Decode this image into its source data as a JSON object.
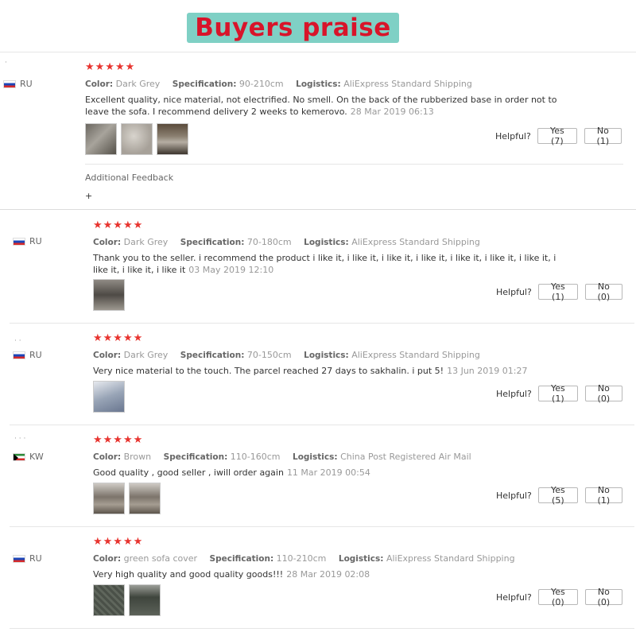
{
  "banner": {
    "title": "Buyers praise"
  },
  "labels": {
    "color": "Color:",
    "specification": "Specification:",
    "logistics": "Logistics:",
    "helpful": "Helpful?",
    "additional_feedback": "Additional Feedback",
    "plus": "+"
  },
  "colors": {
    "stars": "#e8342f",
    "banner_bg": "#7fd0c5",
    "banner_text": "#d8142a"
  },
  "reviews": [
    {
      "country": "RU",
      "flag": "russia-flag",
      "stars": "★★★★★",
      "color": "Dark Grey",
      "specification": "90-210cm",
      "logistics": "AliExpress Standard Shipping",
      "text": "Excellent quality, nice material, not electrified. No smell. On the back of the rubberized base in order not to leave the sofa. I recommend delivery 2 weeks to kemerovo.",
      "date": "28 Mar 2019 06:13",
      "yes": "Yes (7)",
      "no": "No (1)"
    },
    {
      "country": "RU",
      "flag": "russia-flag",
      "stars": "★★★★★",
      "color": "Dark Grey",
      "specification": "70-180cm",
      "logistics": "AliExpress Standard Shipping",
      "text": "Thank you to the seller. i recommend the product i like it, i like it, i like it, i like it, i like it, i like it, i like it, i like it, i like it, i like it",
      "date": "03 May 2019 12:10",
      "yes": "Yes (1)",
      "no": "No (0)"
    },
    {
      "country": "RU",
      "flag": "russia-flag",
      "stars": "★★★★★",
      "color": "Dark Grey",
      "specification": "70-150cm",
      "logistics": "AliExpress Standard Shipping",
      "text": "Very nice material to the touch. The parcel reached 27 days to sakhalin. i put 5!",
      "date": "13 Jun 2019 01:27",
      "yes": "Yes (1)",
      "no": "No (0)"
    },
    {
      "country": "KW",
      "flag": "kuwait-flag",
      "stars": "★★★★★",
      "color": "Brown",
      "specification": "110-160cm",
      "logistics": "China Post Registered Air Mail",
      "text": "Good quality , good seller , iwill order again",
      "date": "11 Mar 2019 00:54",
      "yes": "Yes (5)",
      "no": "No (1)"
    },
    {
      "country": "RU",
      "flag": "russia-flag",
      "stars": "★★★★★",
      "color": "green sofa cover",
      "specification": "110-210cm",
      "logistics": "AliExpress Standard Shipping",
      "text": "Very high quality and good quality goods!!!",
      "date": "28 Mar 2019 02:08",
      "yes": "Yes (0)",
      "no": "No (0)"
    }
  ]
}
